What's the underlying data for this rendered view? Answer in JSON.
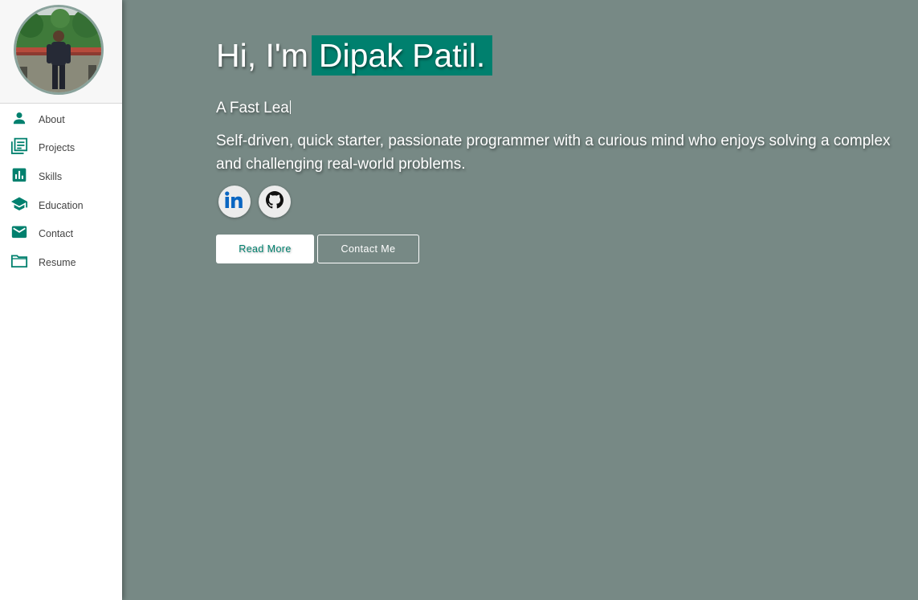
{
  "sidebar": {
    "avatar_alt": "Profile photo",
    "items": [
      {
        "label": "About",
        "icon": "person-icon"
      },
      {
        "label": "Projects",
        "icon": "article-icon"
      },
      {
        "label": "Skills",
        "icon": "bar-chart-icon"
      },
      {
        "label": "Education",
        "icon": "graduation-cap-icon"
      },
      {
        "label": "Contact",
        "icon": "mail-icon"
      },
      {
        "label": "Resume",
        "icon": "folder-icon"
      }
    ]
  },
  "hero": {
    "greeting": "Hi, I'm",
    "name": "Dipak Patil.",
    "typed_text": "A Fast Lea",
    "bio": "Self-driven, quick starter, passionate programmer with a curious mind who enjoys solving a complex and challenging real-world problems."
  },
  "social": [
    {
      "name": "LinkedIn",
      "icon": "linkedin-icon"
    },
    {
      "name": "GitHub",
      "icon": "github-icon"
    }
  ],
  "buttons": {
    "read_more": "Read More",
    "contact_me": "Contact Me"
  },
  "colors": {
    "accent": "#00806e",
    "background": "#778985",
    "sidebar": "#ffffff"
  }
}
